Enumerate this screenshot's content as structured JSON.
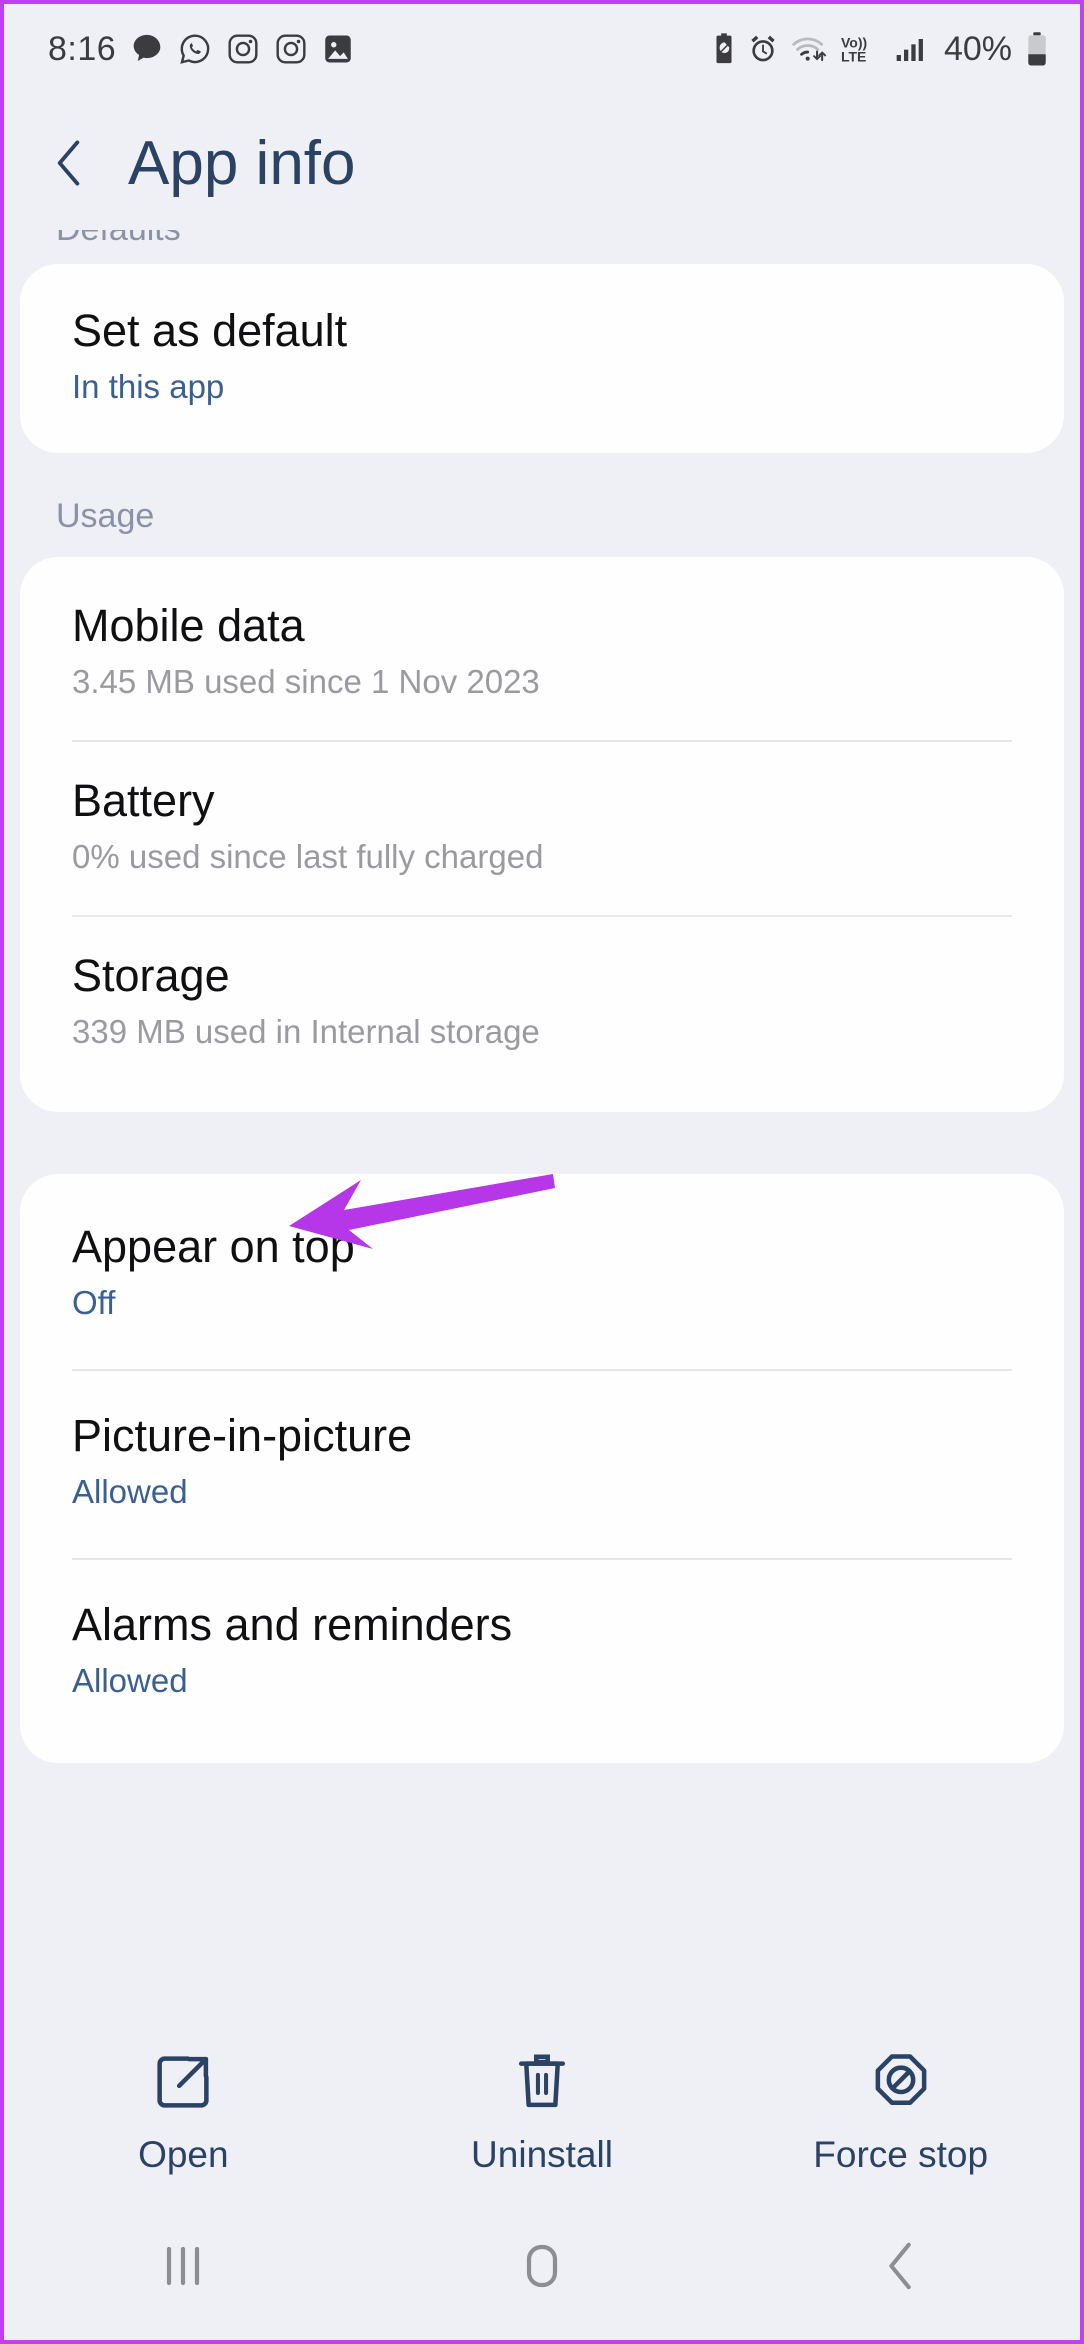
{
  "statusbar": {
    "time": "8:16",
    "battery_percent": "40%",
    "left_icons": [
      "messages-icon",
      "whatsapp-icon",
      "instagram-icon",
      "instagram-icon",
      "gallery-icon"
    ],
    "right_icons": [
      "battery-saver-icon",
      "alarm-icon",
      "wifi-icon",
      "volte-icon",
      "signal-icon",
      "battery-icon"
    ]
  },
  "header": {
    "title": "App info",
    "back_icon": "back-chevron-icon"
  },
  "sections": {
    "defaults_label": "Defaults",
    "usage_label": "Usage"
  },
  "defaults_card": [
    {
      "title": "Set as default",
      "sub": "In this app",
      "sub_style": "blue"
    }
  ],
  "usage_card": [
    {
      "title": "Mobile data",
      "sub": "3.45 MB used since 1 Nov 2023",
      "sub_style": "grey"
    },
    {
      "title": "Battery",
      "sub": "0% used since last fully charged",
      "sub_style": "grey"
    },
    {
      "title": "Storage",
      "sub": "339 MB used in Internal storage",
      "sub_style": "grey"
    }
  ],
  "permissions_card": [
    {
      "title": "Appear on top",
      "sub": "Off",
      "sub_style": "blue"
    },
    {
      "title": "Picture-in-picture",
      "sub": "Allowed",
      "sub_style": "blue"
    },
    {
      "title": "Alarms and reminders",
      "sub": "Allowed",
      "sub_style": "blue"
    }
  ],
  "actions": [
    {
      "label": "Open",
      "icon": "open-external-icon"
    },
    {
      "label": "Uninstall",
      "icon": "trash-icon"
    },
    {
      "label": "Force stop",
      "icon": "force-stop-icon"
    }
  ],
  "navbar": [
    {
      "icon": "recents-icon"
    },
    {
      "icon": "home-icon"
    },
    {
      "icon": "back-icon"
    }
  ],
  "annotation": {
    "type": "arrow",
    "color": "#b537e8",
    "points_to": "Storage"
  },
  "colors": {
    "background": "#eff0f5",
    "card": "#fefeff",
    "accent_blue": "#2a4365",
    "sub_blue": "#3a6091",
    "sub_grey": "#9a9aa0",
    "annotation": "#b537e8",
    "frame_border": "#c13ff0"
  }
}
